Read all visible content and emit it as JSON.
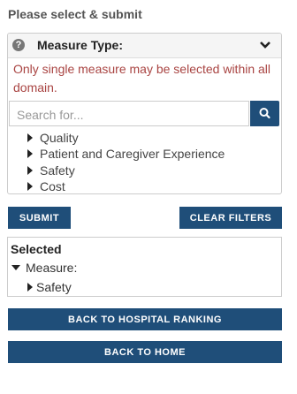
{
  "heading": "Please select & submit",
  "measure_panel": {
    "title": "Measure Type:",
    "warning": "Only single measure may be selected within all domain.",
    "search": {
      "placeholder": "Search for..."
    },
    "domains": [
      "Quality",
      "Patient and Caregiver Experience",
      "Safety",
      "Cost"
    ]
  },
  "actions": {
    "submit_label": "SUBMIT",
    "clear_label": "CLEAR FILTERS"
  },
  "selected": {
    "title": "Selected",
    "measure_label": "Measure:",
    "measure_value": "Safety"
  },
  "nav": {
    "back_ranking_label": "BACK TO HOSPITAL RANKING",
    "back_home_label": "BACK TO HOME"
  },
  "colors": {
    "primary": "#1f4e79",
    "warning": "#a94442"
  },
  "icons": [
    "question-circle-icon",
    "chevron-down-icon",
    "search-icon",
    "caret-right-icon",
    "caret-down-icon"
  ]
}
